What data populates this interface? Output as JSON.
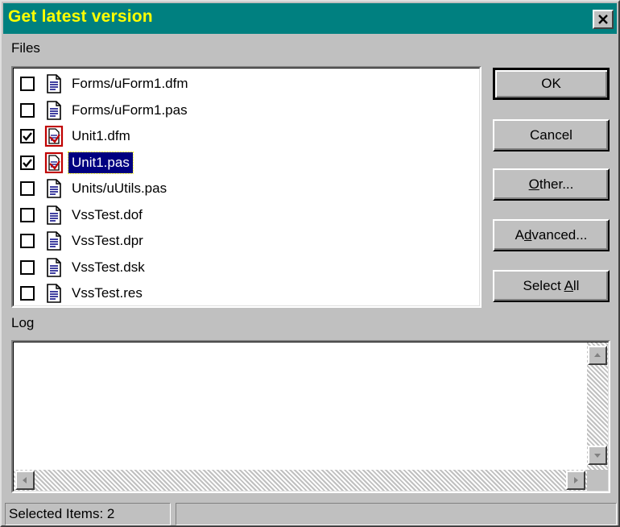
{
  "window": {
    "title": "Get latest version",
    "close_icon": "close-icon"
  },
  "files": {
    "label": "Files",
    "items": [
      {
        "name": "Forms/uForm1.dfm",
        "checked": false,
        "icon": "document-icon",
        "selected": false
      },
      {
        "name": "Forms/uForm1.pas",
        "checked": false,
        "icon": "document-icon",
        "selected": false
      },
      {
        "name": "Unit1.dfm",
        "checked": true,
        "icon": "checked-out-document-icon",
        "selected": false
      },
      {
        "name": "Unit1.pas",
        "checked": true,
        "icon": "checked-out-document-icon",
        "selected": true
      },
      {
        "name": "Units/uUtils.pas",
        "checked": false,
        "icon": "document-icon",
        "selected": false
      },
      {
        "name": "VssTest.dof",
        "checked": false,
        "icon": "document-icon",
        "selected": false
      },
      {
        "name": "VssTest.dpr",
        "checked": false,
        "icon": "document-icon",
        "selected": false
      },
      {
        "name": "VssTest.dsk",
        "checked": false,
        "icon": "document-icon",
        "selected": false
      },
      {
        "name": "VssTest.res",
        "checked": false,
        "icon": "document-icon",
        "selected": false
      }
    ]
  },
  "buttons": {
    "ok": "OK",
    "cancel": "Cancel",
    "other": "Other...",
    "advanced": "Advanced...",
    "select_all": "Select All"
  },
  "log": {
    "label": "Log",
    "content": ""
  },
  "status": {
    "selected_items": "Selected Items: 2",
    "secondary": ""
  },
  "colors": {
    "title_bg": "#008080",
    "title_text": "#ffff00",
    "selection_bg": "#000080",
    "face": "#c0c0c0"
  }
}
